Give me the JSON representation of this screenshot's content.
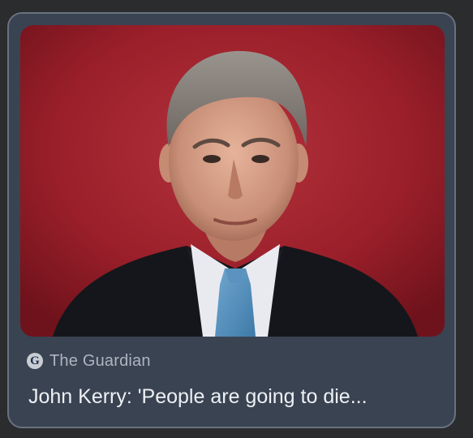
{
  "card": {
    "source": {
      "icon": "guardian-logo-icon",
      "name": "The Guardian"
    },
    "headline": "John Kerry: 'People are going to die...",
    "thumbnail": {
      "background": "#9a1f2a"
    }
  }
}
